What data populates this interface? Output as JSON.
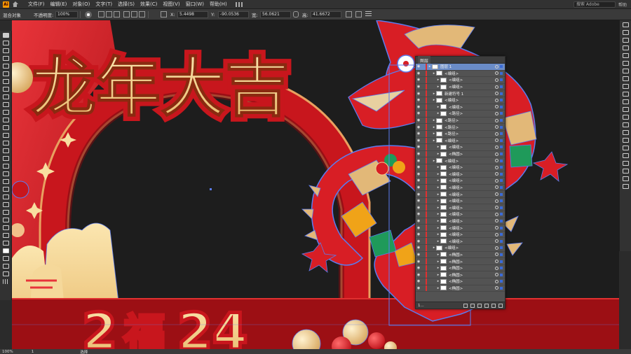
{
  "app": {
    "logo": "Ai"
  },
  "menu": {
    "items": [
      "文件(F)",
      "编辑(E)",
      "对象(O)",
      "文字(T)",
      "选择(S)",
      "效果(C)",
      "视图(V)",
      "窗口(W)",
      "帮助(H)"
    ],
    "search_placeholder": "搜索 Adobe",
    "help": "帮助"
  },
  "control": {
    "selection_label": "混合对象",
    "opacity_label": "不透明度:",
    "opacity_value": "100%",
    "x_label": "X:",
    "x_value": "5.4498",
    "y_label": "Y:",
    "y_value": "-90.0536",
    "w_label": "宽:",
    "w_value": "56.0621",
    "h_label": "高:",
    "h_value": "41.6672"
  },
  "artwork": {
    "title_chars": "龙年大吉",
    "number_left": "2",
    "number_mid": "福",
    "number_right": "24"
  },
  "layers_panel": {
    "tab": "图层",
    "rows": [
      {
        "name": "图层 1",
        "indent": 0,
        "top": true
      },
      {
        "name": "<编组>",
        "indent": 1
      },
      {
        "name": "<编组>",
        "indent": 2
      },
      {
        "name": "<编组>",
        "indent": 2
      },
      {
        "name": "新建符号 1",
        "indent": 1
      },
      {
        "name": "<编组>",
        "indent": 1
      },
      {
        "name": "<编组>",
        "indent": 2
      },
      {
        "name": "<路径>",
        "indent": 2
      },
      {
        "name": "<路径>",
        "indent": 1
      },
      {
        "name": "<路径>",
        "indent": 1
      },
      {
        "name": "<路径>",
        "indent": 1
      },
      {
        "name": "<编组>",
        "indent": 1
      },
      {
        "name": "<编组>",
        "indent": 2
      },
      {
        "name": "<椭圆>",
        "indent": 2
      },
      {
        "name": "<编组>",
        "indent": 1
      },
      {
        "name": "<编组>",
        "indent": 2
      },
      {
        "name": "<编组>",
        "indent": 2
      },
      {
        "name": "<编组>",
        "indent": 2
      },
      {
        "name": "<编组>",
        "indent": 2
      },
      {
        "name": "<编组>",
        "indent": 2
      },
      {
        "name": "<编组>",
        "indent": 2
      },
      {
        "name": "<编组>",
        "indent": 2
      },
      {
        "name": "<编组>",
        "indent": 2
      },
      {
        "name": "<编组>",
        "indent": 2
      },
      {
        "name": "<编组>",
        "indent": 2
      },
      {
        "name": "<编组>",
        "indent": 2
      },
      {
        "name": "<编组>",
        "indent": 2
      },
      {
        "name": "<编组>",
        "indent": 1
      },
      {
        "name": "<椭圆>",
        "indent": 2
      },
      {
        "name": "<椭圆>",
        "indent": 2
      },
      {
        "name": "<椭圆>",
        "indent": 2
      },
      {
        "name": "<椭圆>",
        "indent": 2
      },
      {
        "name": "<椭圆>",
        "indent": 2
      },
      {
        "name": "<椭圆>",
        "indent": 2
      }
    ],
    "footer_count": "1..."
  },
  "status": {
    "zoom": "100%",
    "artboard": "1",
    "tool": "选择"
  },
  "colors": {
    "accent_red": "#d81e25",
    "gold": "#f2d48a",
    "selection_blue": "#5b7cf0"
  }
}
